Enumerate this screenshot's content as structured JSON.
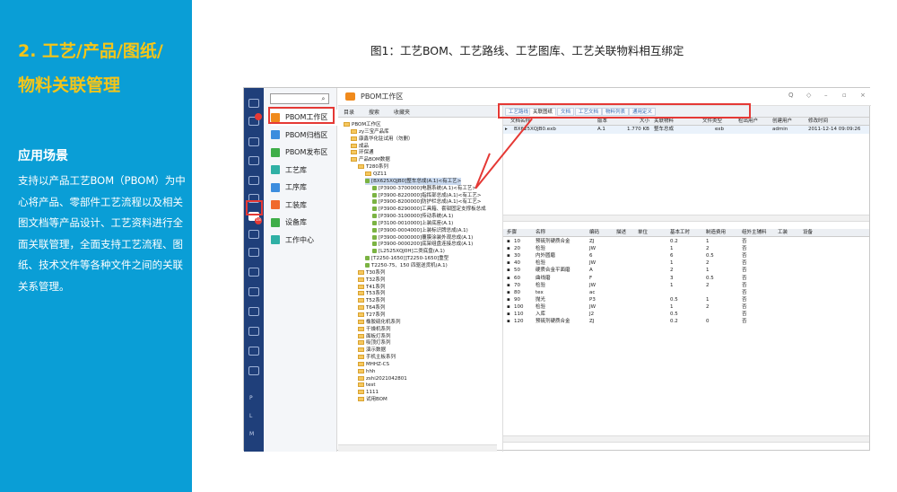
{
  "slide": {
    "heading": "2. 工艺/产品/图纸/\n物料关联管理",
    "section_title": "应用场景",
    "description": "支持以产品工艺BOM（PBOM）为中心将产品、零部件工艺流程以及相关图文档等产品设计、工艺资料进行全面关联管理，全面支持工艺流程、图纸、技术文件等各种文件之间的关联关系管理。",
    "figure_caption": "图1：工艺BOM、工艺路线、工艺图库、工艺关联物料相互绑定",
    "accent_color": "#f5c518",
    "panel_color": "#0a9ed6"
  },
  "app": {
    "window_title": "PBOM工作区",
    "window_controls": [
      "Q",
      "◇",
      "–",
      "▫",
      "×"
    ],
    "iconbar_letters": [
      "P",
      "L",
      "M"
    ],
    "iconbar_badges": [
      "18"
    ],
    "nav_items": [
      {
        "label": "PBOM工作区",
        "color": "#f08a1c",
        "active": true
      },
      {
        "label": "PBOM归档区",
        "color": "#3c8dde",
        "active": false
      },
      {
        "label": "PBOM发布区",
        "color": "#3fae49",
        "active": false
      },
      {
        "label": "工艺库",
        "color": "#2fb0a5",
        "active": false
      },
      {
        "label": "工序库",
        "color": "#3c8dde",
        "active": false
      },
      {
        "label": "工装库",
        "color": "#f06a2c",
        "active": false
      },
      {
        "label": "设备库",
        "color": "#3fae49",
        "active": false
      },
      {
        "label": "工作中心",
        "color": "#2fb0a5",
        "active": false
      }
    ],
    "tree_tabs": [
      "目录",
      "搜索",
      "收藏夹"
    ],
    "tree_rows": [
      {
        "indent": 0,
        "text": "PBOM工作区",
        "icon": "folder"
      },
      {
        "indent": 1,
        "text": "zy三宝产品库",
        "icon": "folder"
      },
      {
        "indent": 1,
        "text": "康鑫华化驻试用（勿删）",
        "icon": "folder"
      },
      {
        "indent": 1,
        "text": "成品",
        "icon": "folder"
      },
      {
        "indent": 1,
        "text": "环保通",
        "icon": "folder"
      },
      {
        "indent": 1,
        "text": "产品BOM数据",
        "icon": "folder"
      },
      {
        "indent": 2,
        "text": "T280系列",
        "icon": "folder"
      },
      {
        "indent": 3,
        "text": "QZ11",
        "icon": "folder"
      },
      {
        "indent": 3,
        "text": "[BX625XQJB0]整车总成(A.1)<有工艺>",
        "icon": "part",
        "selected": true
      },
      {
        "indent": 4,
        "text": "[P3900-3700000]电器系统(A.1)<有工艺>",
        "icon": "part"
      },
      {
        "indent": 4,
        "text": "[P3900-8220000]指挥部总成(A.1)<有工艺>",
        "icon": "part"
      },
      {
        "indent": 4,
        "text": "[P3900-8200000]防护栏总成(A.1)<有工艺>",
        "icon": "part"
      },
      {
        "indent": 4,
        "text": "[P3900-8290000]工具箱、套钳固定支撑板总成",
        "icon": "part"
      },
      {
        "indent": 4,
        "text": "[P3900-3100000]传动系统(A.1)",
        "icon": "part"
      },
      {
        "indent": 4,
        "text": "[P3100-0010000]上装底座(A.1)",
        "icon": "part"
      },
      {
        "indent": 4,
        "text": "[P3900-0004000]上装标识牌总成(A.1)",
        "icon": "part"
      },
      {
        "indent": 4,
        "text": "[P3900-0000000]覆膜涂装外观总成(A.1)",
        "icon": "part"
      },
      {
        "indent": 4,
        "text": "[P3900-0000200]底架组盘连接总成(A.1)",
        "icon": "part"
      },
      {
        "indent": 4,
        "text": "[L2525XQJ0H]二类底盘(A.1)",
        "icon": "part"
      },
      {
        "indent": 3,
        "text": "[T2250-1650]]T2250-1650]重型",
        "icon": "part"
      },
      {
        "indent": 3,
        "text": "T2250-75、150 四驱送货机(A.1)",
        "icon": "part"
      },
      {
        "indent": 2,
        "text": "T30系列",
        "icon": "folder"
      },
      {
        "indent": 2,
        "text": "T32系列",
        "icon": "folder"
      },
      {
        "indent": 2,
        "text": "T41系列",
        "icon": "folder"
      },
      {
        "indent": 2,
        "text": "T53系列",
        "icon": "folder"
      },
      {
        "indent": 2,
        "text": "T52系列",
        "icon": "folder"
      },
      {
        "indent": 2,
        "text": "T64系列",
        "icon": "folder"
      },
      {
        "indent": 2,
        "text": "T27系列",
        "icon": "folder"
      },
      {
        "indent": 2,
        "text": "橡胶硫化机系列",
        "icon": "folder"
      },
      {
        "indent": 2,
        "text": "干燥机系列",
        "icon": "folder"
      },
      {
        "indent": 2,
        "text": "面板灯系列",
        "icon": "folder"
      },
      {
        "indent": 2,
        "text": "吸顶灯系列",
        "icon": "folder"
      },
      {
        "indent": 2,
        "text": "演示数据",
        "icon": "folder"
      },
      {
        "indent": 2,
        "text": "手机主板系列",
        "icon": "folder"
      },
      {
        "indent": 2,
        "text": "MHHZ-CS",
        "icon": "folder"
      },
      {
        "indent": 2,
        "text": "hhh",
        "icon": "folder"
      },
      {
        "indent": 2,
        "text": "zshi2021042801",
        "icon": "folder"
      },
      {
        "indent": 2,
        "text": "test",
        "icon": "folder"
      },
      {
        "indent": 2,
        "text": "1111",
        "icon": "folder"
      },
      {
        "indent": 2,
        "text": "试用BOM",
        "icon": "folder"
      }
    ],
    "detail_tabs": [
      "工艺路线",
      "关联图纸",
      "文档",
      "工艺文档",
      "物料列表",
      "通用定义"
    ],
    "doc_grid": {
      "headers": [
        "文档名称",
        "版本",
        "大小",
        "关联物料",
        "文件类型",
        "检出用户",
        "创建用户",
        "修改时间"
      ],
      "rows": [
        [
          "BX625XQJB0.exb",
          "A.1",
          "1.770 KB",
          "整车总成",
          "exb",
          "",
          "admin",
          "2011-12-14 09:09:26"
        ]
      ]
    },
    "route_grid": {
      "headers": [
        "步骤",
        "名称",
        "编码",
        "描述",
        "单位",
        "基本工时",
        "制造费用",
        "组外主辅料",
        "工装",
        "设备"
      ],
      "rows": [
        [
          "10",
          "预硫剂硬质合金",
          "ZJ",
          "",
          "",
          "0.2",
          "1",
          "否",
          "",
          ""
        ],
        [
          "20",
          "检验",
          "JW",
          "",
          "",
          "1",
          "2",
          "否",
          "",
          ""
        ],
        [
          "30",
          "内外圆磨",
          "6",
          "",
          "",
          "6",
          "0.5",
          "否",
          "",
          ""
        ],
        [
          "40",
          "检验",
          "JW",
          "",
          "",
          "1",
          "2",
          "否",
          "",
          ""
        ],
        [
          "50",
          "硬质合金平面磨",
          "A",
          "",
          "",
          "2",
          "1",
          "否",
          "",
          ""
        ],
        [
          "60",
          "曲线磨",
          "F",
          "",
          "",
          "3",
          "0.5",
          "否",
          "",
          ""
        ],
        [
          "70",
          "检验",
          "JW",
          "",
          "",
          "1",
          "2",
          "否",
          "",
          ""
        ],
        [
          "80",
          "tex",
          "ac",
          "",
          "",
          "",
          "",
          "否",
          "",
          ""
        ],
        [
          "90",
          "抛光",
          "P3",
          "",
          "",
          "0.5",
          "1",
          "否",
          "",
          ""
        ],
        [
          "100",
          "检验",
          "JW",
          "",
          "",
          "1",
          "2",
          "否",
          "",
          ""
        ],
        [
          "110",
          "入库",
          "J2",
          "",
          "",
          "0.5",
          "",
          "否",
          "",
          ""
        ],
        [
          "120",
          "预硫剂硬质合金",
          "ZJ",
          "",
          "",
          "0.2",
          "0",
          "否",
          "",
          ""
        ]
      ]
    }
  }
}
